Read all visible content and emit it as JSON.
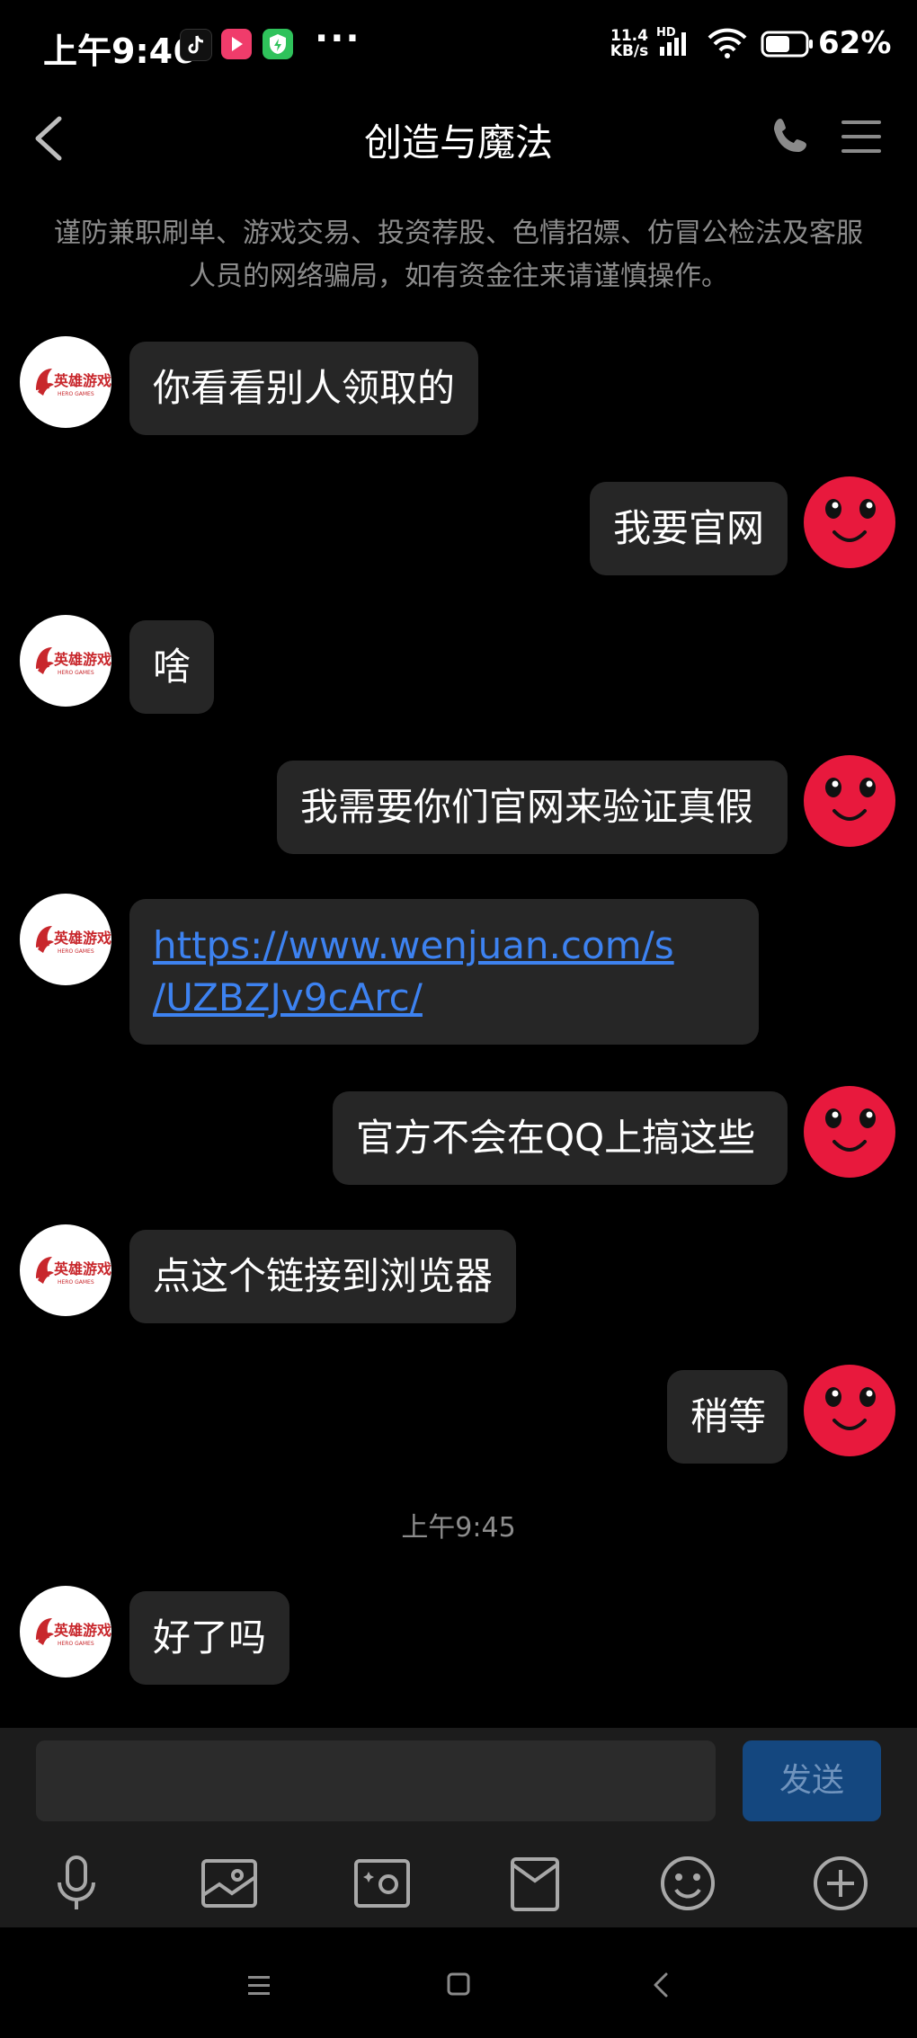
{
  "status_bar": {
    "time": "上午9:46",
    "more": "···",
    "net_speed_value": "11.4",
    "net_speed_unit": "KB/s",
    "network_badge": "HD",
    "battery_percent": "62%",
    "battery_level": 0.62
  },
  "header": {
    "title": "创造与魔法"
  },
  "warning_text": "谨防兼职刷单、游戏交易、投资荐股、色情招嫖、仿冒公检法及客服人员的网络骗局，如有资金往来请谨慎操作。",
  "avatar_logo": {
    "name": "英雄游戏",
    "sub": "HERO GAMES",
    "color": "#c8272c"
  },
  "messages": [
    {
      "side": "left",
      "text": "你看看别人领取的"
    },
    {
      "side": "right",
      "text": "我要官网"
    },
    {
      "side": "left",
      "text": "啥"
    },
    {
      "side": "right",
      "text": "我需要你们官网来验证真假"
    },
    {
      "side": "left",
      "text": "https://www.wenjuan.com/s/UZBZJv9cArc/",
      "link_line1": "https://www.wenjuan.com/s",
      "link_line2": "/UZBZJv9cArc/"
    },
    {
      "side": "right",
      "text": "官方不会在QQ上搞这些"
    },
    {
      "side": "left",
      "text": "点这个链接到浏览器"
    },
    {
      "side": "right",
      "text": "稍等"
    },
    {
      "side": "left",
      "text": "好了吗"
    }
  ],
  "timestamp": "上午9:45",
  "input": {
    "placeholder": "",
    "send_label": "发送"
  },
  "toolbar": [
    "microphone-icon",
    "image-icon",
    "camera-icon",
    "red-packet-icon",
    "emoji-icon",
    "plus-icon"
  ],
  "colors": {
    "bubble": "#262626",
    "link": "#3d82f0",
    "self_avatar": "#e8193d",
    "send_button": "#14477f"
  }
}
